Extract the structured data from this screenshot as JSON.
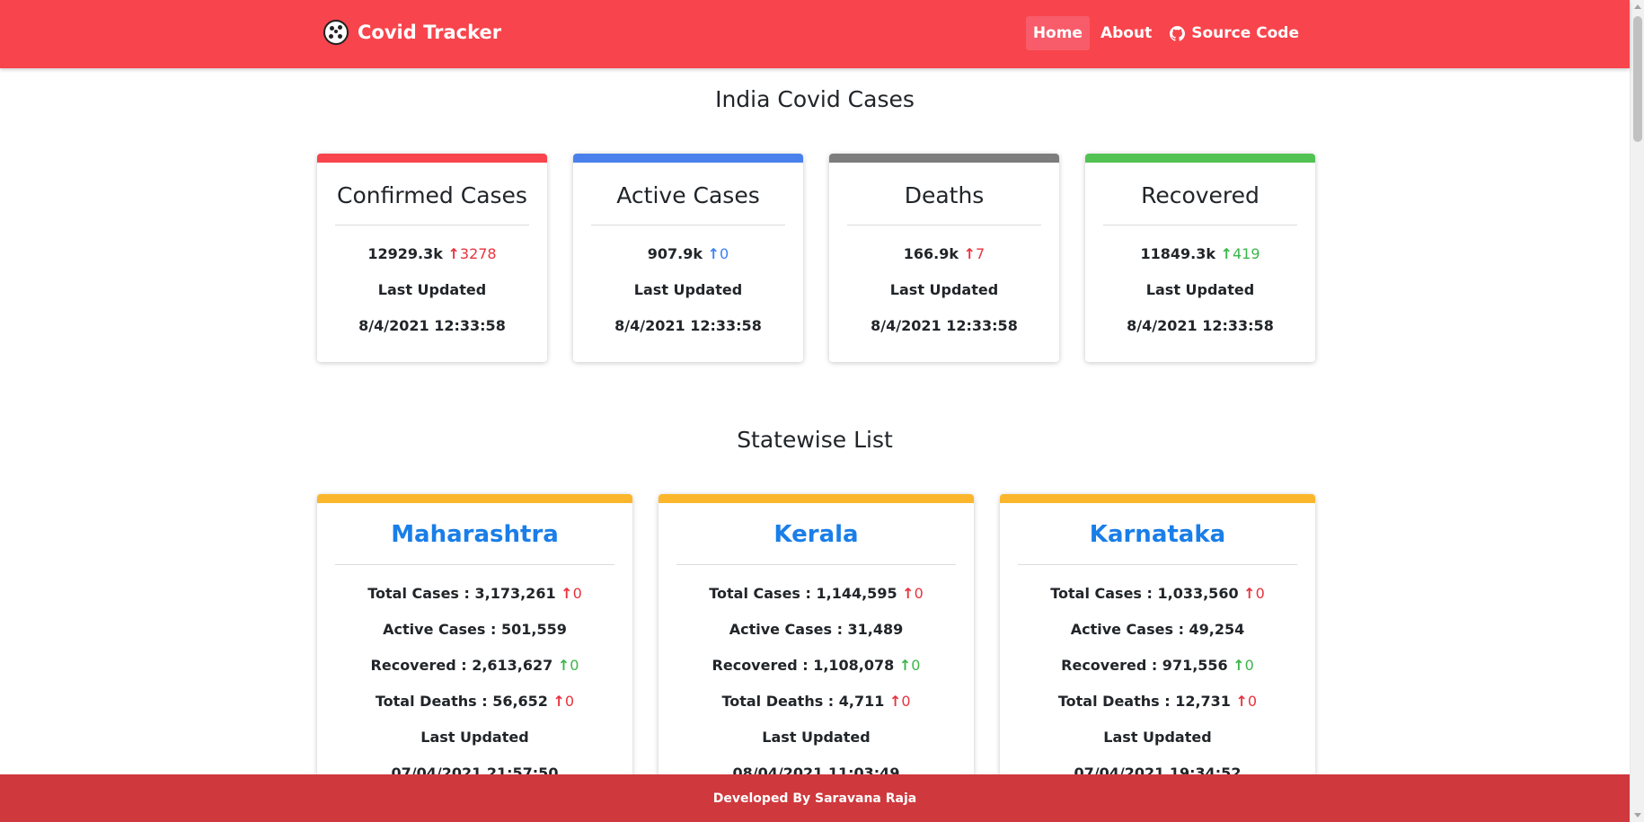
{
  "app": {
    "brand": "Covid Tracker"
  },
  "nav": {
    "home": "Home",
    "about": "About",
    "source": "Source Code"
  },
  "colors": {
    "navbar": "#f8444c",
    "confirmed": "#f8444c",
    "active": "#4a80eb",
    "deaths": "#7c7c7c",
    "recovered": "#52c253",
    "state_bar": "#fbb62c",
    "footer": "#cf383c"
  },
  "india": {
    "title": "India Covid Cases",
    "cards": [
      {
        "title": "Confirmed Cases",
        "value": "12929.3k",
        "delta": "3278",
        "updated_label": "Last Updated",
        "updated": "8/4/2021 12:33:58"
      },
      {
        "title": "Active Cases",
        "value": "907.9k",
        "delta": "0",
        "updated_label": "Last Updated",
        "updated": "8/4/2021 12:33:58"
      },
      {
        "title": "Deaths",
        "value": "166.9k",
        "delta": "7",
        "updated_label": "Last Updated",
        "updated": "8/4/2021 12:33:58"
      },
      {
        "title": "Recovered",
        "value": "11849.3k",
        "delta": "419",
        "updated_label": "Last Updated",
        "updated": "8/4/2021 12:33:58"
      }
    ]
  },
  "statewise": {
    "title": "Statewise List",
    "states": [
      {
        "name": "Maharashtra",
        "total": "Total Cases : 3,173,261",
        "total_delta": "0",
        "active": "Active Cases : 501,559",
        "recovered": "Recovered : 2,613,627",
        "recovered_delta": "0",
        "deaths": "Total Deaths : 56,652",
        "deaths_delta": "0",
        "updated_label": "Last Updated",
        "updated": "07/04/2021 21:57:50"
      },
      {
        "name": "Kerala",
        "total": "Total Cases : 1,144,595",
        "total_delta": "0",
        "active": "Active Cases : 31,489",
        "recovered": "Recovered : 1,108,078",
        "recovered_delta": "0",
        "deaths": "Total Deaths : 4,711",
        "deaths_delta": "0",
        "updated_label": "Last Updated",
        "updated": "08/04/2021 11:03:49"
      },
      {
        "name": "Karnataka",
        "total": "Total Cases : 1,033,560",
        "total_delta": "0",
        "active": "Active Cases : 49,254",
        "recovered": "Recovered : 971,556",
        "recovered_delta": "0",
        "deaths": "Total Deaths : 12,731",
        "deaths_delta": "0",
        "updated_label": "Last Updated",
        "updated": "07/04/2021 19:34:52"
      }
    ]
  },
  "footer": {
    "text": "Developed By Saravana Raja"
  }
}
